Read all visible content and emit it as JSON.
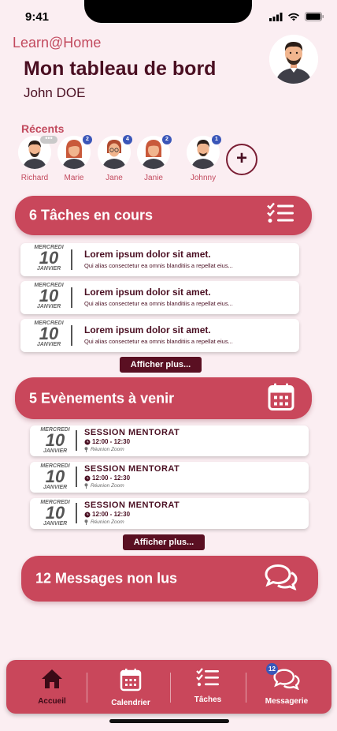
{
  "status": {
    "time": "9:41"
  },
  "header": {
    "app_name": "Learn@Home",
    "title": "Mon tableau de bord",
    "user": "John DOE"
  },
  "recents": {
    "label": "Récents",
    "people": [
      {
        "name": "Richard",
        "badge": "•••"
      },
      {
        "name": "Marie",
        "badge": "2"
      },
      {
        "name": "Jane",
        "badge": "4"
      },
      {
        "name": "Janie",
        "badge": "2"
      },
      {
        "name": "Johnny",
        "badge": "1"
      }
    ],
    "add_label": "+"
  },
  "tasks": {
    "header": "6 Tâches en cours",
    "items": [
      {
        "day_name": "MERCREDI",
        "day": "10",
        "month": "JANVIER",
        "title": "Lorem ipsum dolor sit amet.",
        "desc": "Qui alias consectetur ea omnis blanditiis a repellat eius..."
      },
      {
        "day_name": "MERCREDI",
        "day": "10",
        "month": "JANVIER",
        "title": "Lorem ipsum dolor sit amet.",
        "desc": "Qui alias consectetur ea omnis blanditiis a repellat eius..."
      },
      {
        "day_name": "MERCREDI",
        "day": "10",
        "month": "JANVIER",
        "title": "Lorem ipsum dolor sit amet.",
        "desc": "Qui alias consectetur ea omnis blanditiis a repellat eius..."
      }
    ],
    "more": "Afficher plus..."
  },
  "events": {
    "header": "5 Evènements à venir",
    "items": [
      {
        "day_name": "MERCREDI",
        "day": "10",
        "month": "JANVIER",
        "title": "SESSION MENTORAT",
        "time": "12:00 - 12:30",
        "location": "Réunion Zoom"
      },
      {
        "day_name": "MERCREDI",
        "day": "10",
        "month": "JANVIER",
        "title": "SESSION MENTORAT",
        "time": "12:00 - 12:30",
        "location": "Réunion Zoom"
      },
      {
        "day_name": "MERCREDI",
        "day": "10",
        "month": "JANVIER",
        "title": "SESSION MENTORAT",
        "time": "12:00 - 12:30",
        "location": "Réunion Zoom"
      }
    ],
    "more": "Afficher plus..."
  },
  "messages": {
    "header": "12 Messages non lus"
  },
  "nav": {
    "items": [
      {
        "label": "Accueil",
        "icon": "home-icon"
      },
      {
        "label": "Calendrier",
        "icon": "calendar-icon"
      },
      {
        "label": "Tâches",
        "icon": "checklist-icon"
      },
      {
        "label": "Messagerie",
        "icon": "chat-icon"
      }
    ],
    "badge": "12"
  },
  "colors": {
    "accent": "#c9475b",
    "dark": "#4a0f22",
    "background": "#fbeef2",
    "badge": "#3a56b8"
  }
}
